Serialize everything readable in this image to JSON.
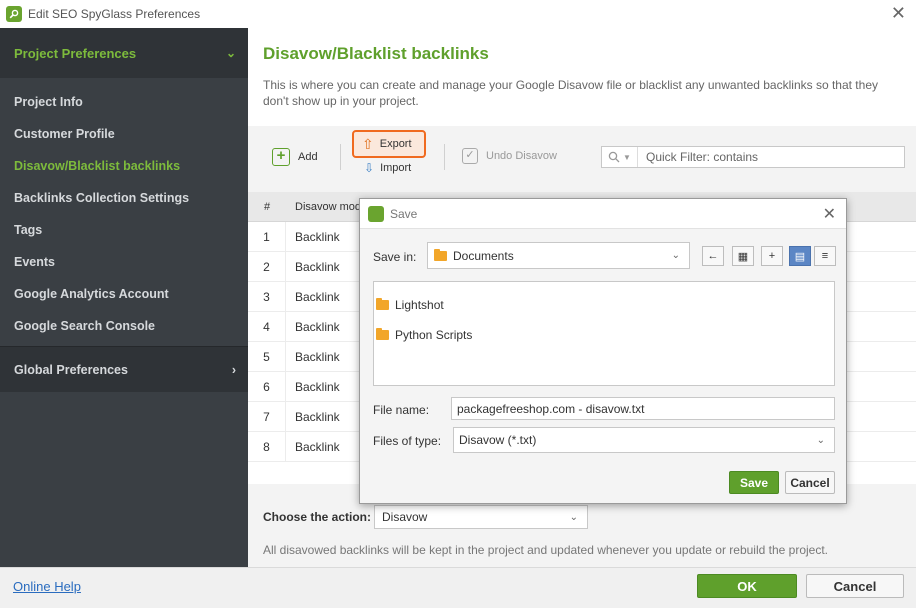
{
  "window": {
    "title": "Edit SEO SpyGlass Preferences",
    "close_glyph": "✕"
  },
  "sidebar": {
    "section_title": "Project Preferences",
    "section_chevron": "⌄",
    "items": [
      {
        "label": "Project Info",
        "active": false
      },
      {
        "label": "Customer Profile",
        "active": false
      },
      {
        "label": "Disavow/Blacklist backlinks",
        "active": true
      },
      {
        "label": "Backlinks Collection Settings",
        "active": false
      },
      {
        "label": "Tags",
        "active": false
      },
      {
        "label": "Events",
        "active": false
      },
      {
        "label": "Google Analytics Account",
        "active": false
      },
      {
        "label": "Google Search Console",
        "active": false
      }
    ],
    "global_title": "Global Preferences",
    "global_chevron": "›"
  },
  "main": {
    "title": "Disavow/Blacklist backlinks",
    "description": "This is where you can create and manage your Google Disavow file or blacklist any unwanted backlinks so that they don't show up in your project."
  },
  "toolbar": {
    "add_label": "Add",
    "export_label": "Export",
    "import_label": "Import",
    "undo_label": "Undo Disavow",
    "filter_placeholder": "Quick Filter: contains"
  },
  "table": {
    "columns": [
      "#",
      "Disavow mode"
    ],
    "rows": [
      {
        "num": "1",
        "mode": "Backlink"
      },
      {
        "num": "2",
        "mode": "Backlink"
      },
      {
        "num": "3",
        "mode": "Backlink"
      },
      {
        "num": "4",
        "mode": "Backlink"
      },
      {
        "num": "5",
        "mode": "Backlink"
      },
      {
        "num": "6",
        "mode": "Backlink"
      },
      {
        "num": "7",
        "mode": "Backlink"
      },
      {
        "num": "8",
        "mode": "Backlink"
      }
    ]
  },
  "action": {
    "label": "Choose the action:",
    "value": "Disavow",
    "note": "All disavowed backlinks will be kept in the project and updated whenever you update or rebuild the project."
  },
  "bottom": {
    "help_link": "Online Help",
    "ok_label": "OK",
    "cancel_label": "Cancel"
  },
  "save_dialog": {
    "title": "Save",
    "save_in_label": "Save in:",
    "save_in_value": "Documents",
    "files": [
      "Lightshot",
      "Python Scripts"
    ],
    "file_name_label": "File name:",
    "file_name_value": "packagefreeshop.com - disavow.txt",
    "file_type_label": "Files of type:",
    "file_type_value": "Disavow (*.txt)",
    "save_label": "Save",
    "cancel_label": "Cancel"
  },
  "colors": {
    "accent_green": "#5fa02c",
    "sidebar_bg": "#3a3f44",
    "export_highlight": "#f06a1f",
    "link_blue": "#2a6cbf"
  },
  "icons": {
    "app": "seo-spyglass-icon",
    "add": "plus-icon",
    "export": "export-icon",
    "import": "import-icon",
    "undo": "undo-check-icon",
    "search": "search-icon",
    "folder": "folder-icon"
  }
}
